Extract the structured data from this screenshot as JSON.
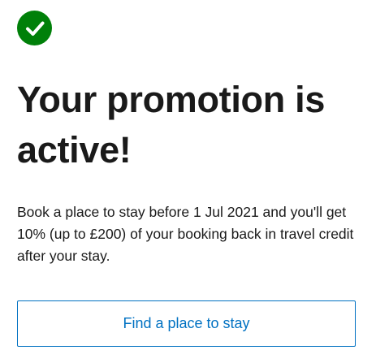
{
  "status": {
    "icon": "check-circle-icon",
    "icon_color": "#008009"
  },
  "title": "Your promotion is active!",
  "description": "Book a place to stay before 1 Jul 2021 and you'll get 10% (up to £200) of your booking back in travel credit after your stay.",
  "cta": {
    "label": "Find a place to stay",
    "color": "#0071c2"
  }
}
